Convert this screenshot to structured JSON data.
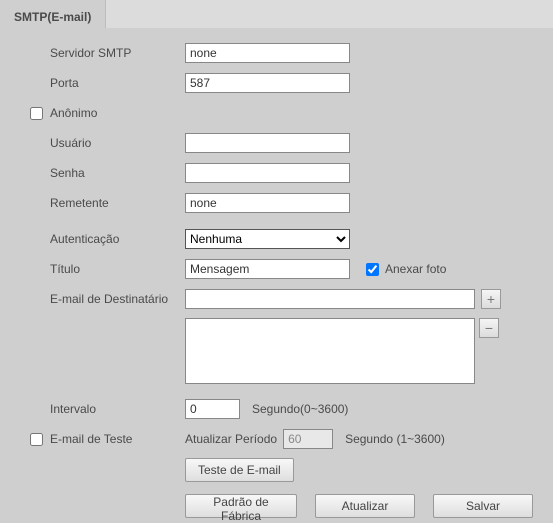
{
  "tab": {
    "label": "SMTP(E-mail)"
  },
  "labels": {
    "server": "Servidor SMTP",
    "port": "Porta",
    "anonymous": "Anônimo",
    "user": "Usuário",
    "password": "Senha",
    "sender": "Remetente",
    "auth": "Autenticação",
    "title": "Título",
    "attach": "Anexar foto",
    "recipient": "E-mail de Destinatário",
    "interval": "Intervalo",
    "interval_suffix": "Segundo(0~3600)",
    "test_email": "E-mail de Teste",
    "update_period": "Atualizar Período",
    "update_period_suffix": "Segundo (1~3600)"
  },
  "values": {
    "server": "none",
    "port": "587",
    "user": "",
    "password": "",
    "sender": "none",
    "auth_selected": "Nenhuma",
    "title": "Mensagem",
    "recipient_input": "",
    "recipient_list": "",
    "interval": "0",
    "update_period": "60",
    "anonymous_checked": false,
    "attach_checked": true,
    "test_checked": false
  },
  "buttons": {
    "test": "Teste de E-mail",
    "default": "Padrão de Fábrica",
    "refresh": "Atualizar",
    "save": "Salvar",
    "add": "+",
    "remove": "−"
  }
}
